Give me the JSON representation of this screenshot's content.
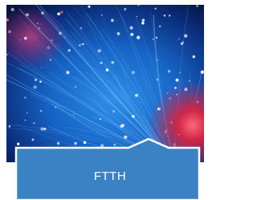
{
  "tile": {
    "label": "FTTH",
    "image": "fiber-optic-strands",
    "colors": {
      "panel": "#3b82c4",
      "panel_border": "#ffffff",
      "label_text": "#ffffff",
      "photo_blue": "#1569c9",
      "photo_dark": "#071a4a",
      "photo_red": "#e0203a"
    }
  }
}
